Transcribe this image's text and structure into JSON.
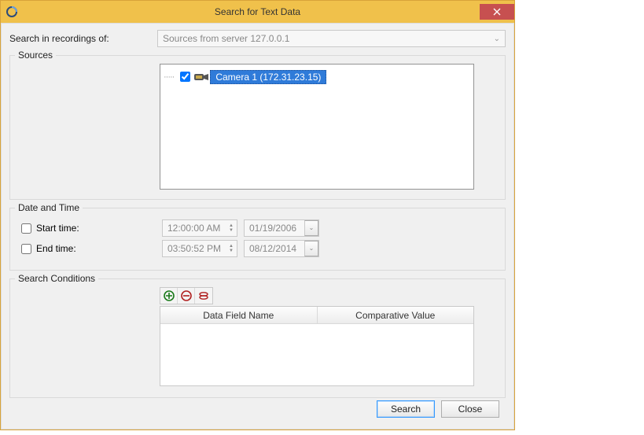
{
  "title": "Search for Text Data",
  "searchIn": {
    "label": "Search in recordings of:",
    "value": "Sources from server 127.0.0.1"
  },
  "sources": {
    "legend": "Sources",
    "items": [
      {
        "checked": true,
        "label": "Camera 1 (172.31.23.15)"
      }
    ]
  },
  "dateTime": {
    "legend": "Date and Time",
    "start": {
      "label": "Start time:",
      "time": "12:00:00 AM",
      "date": "01/19/2006",
      "checked": false
    },
    "end": {
      "label": "End time:",
      "time": "03:50:52 PM",
      "date": "08/12/2014",
      "checked": false
    }
  },
  "conditions": {
    "legend": "Search Conditions",
    "columns": [
      "Data Field Name",
      "Comparative Value"
    ]
  },
  "buttons": {
    "search": "Search",
    "close": "Close"
  }
}
